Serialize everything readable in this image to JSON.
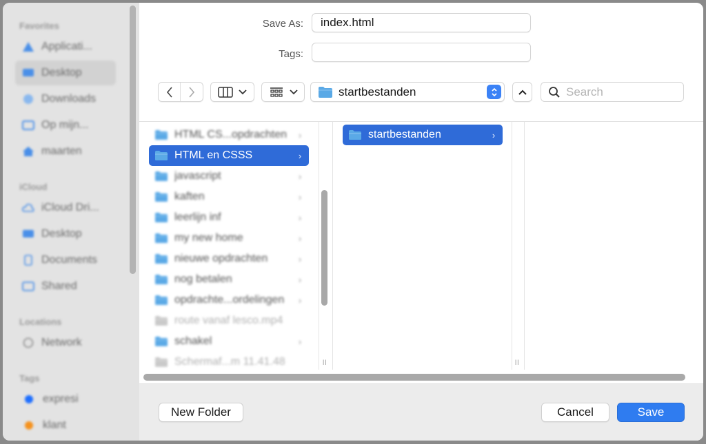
{
  "sidebar": {
    "sections": [
      {
        "title": "Favorites"
      },
      {
        "title": "iCloud"
      },
      {
        "title": "Locations"
      },
      {
        "title": "Tags"
      }
    ],
    "items": [
      {
        "label": "Applicati...",
        "icon": "applications-icon"
      },
      {
        "label": "Desktop",
        "icon": "desktop-icon",
        "selected": true
      },
      {
        "label": "Downloads",
        "icon": "downloads-icon"
      },
      {
        "label": "Op mijn...",
        "icon": "folder-icon"
      },
      {
        "label": "maarten",
        "icon": "home-icon"
      },
      {
        "label": "iCloud Dri...",
        "icon": "cloud-icon"
      },
      {
        "label": "Desktop",
        "icon": "desktop-icon"
      },
      {
        "label": "Documents",
        "icon": "document-icon"
      },
      {
        "label": "Shared",
        "icon": "shared-folder-icon"
      },
      {
        "label": "Network",
        "icon": "network-icon"
      },
      {
        "label": "expresi",
        "color": "#1e6fff"
      },
      {
        "label": "klant",
        "color": "#f5921e"
      }
    ]
  },
  "form": {
    "save_as_label": "Save As:",
    "save_as_value": "index.html",
    "tags_label": "Tags:",
    "tags_value": ""
  },
  "toolbar": {
    "path": "startbestanden",
    "search_placeholder": "Search"
  },
  "columns": {
    "col1": [
      {
        "label": "HTML CS...opdrachten",
        "chevron": "›",
        "state": "blur"
      },
      {
        "label": "HTML en CSSS",
        "chevron": "›",
        "state": "selected"
      },
      {
        "label": "javascript",
        "chevron": "›",
        "state": "blur"
      },
      {
        "label": "kaften",
        "chevron": "›",
        "state": "blur"
      },
      {
        "label": "leerlijn inf",
        "chevron": "›",
        "state": "blur"
      },
      {
        "label": "my new home",
        "chevron": "›",
        "state": "blur"
      },
      {
        "label": "nieuwe opdrachten",
        "chevron": "›",
        "state": "blur"
      },
      {
        "label": "nog betalen",
        "chevron": "›",
        "state": "blur"
      },
      {
        "label": "opdrachte...ordelingen",
        "chevron": "›",
        "state": "blur"
      },
      {
        "label": "route vanaf lesco.mp4",
        "chevron": "",
        "state": "blur-dim"
      },
      {
        "label": "schakel",
        "chevron": "›",
        "state": "blur"
      },
      {
        "label": "Schermaf...m 11.41.48",
        "chevron": "",
        "state": "blur-dim"
      }
    ],
    "col2": [
      {
        "label": "startbestanden",
        "chevron": "›",
        "state": "selected"
      }
    ]
  },
  "buttons": {
    "new_folder": "New Folder",
    "cancel": "Cancel",
    "save": "Save"
  },
  "colors": {
    "accent": "#2f7cf0",
    "selection": "#2f6bd8",
    "folder": "#5aa9e6"
  }
}
